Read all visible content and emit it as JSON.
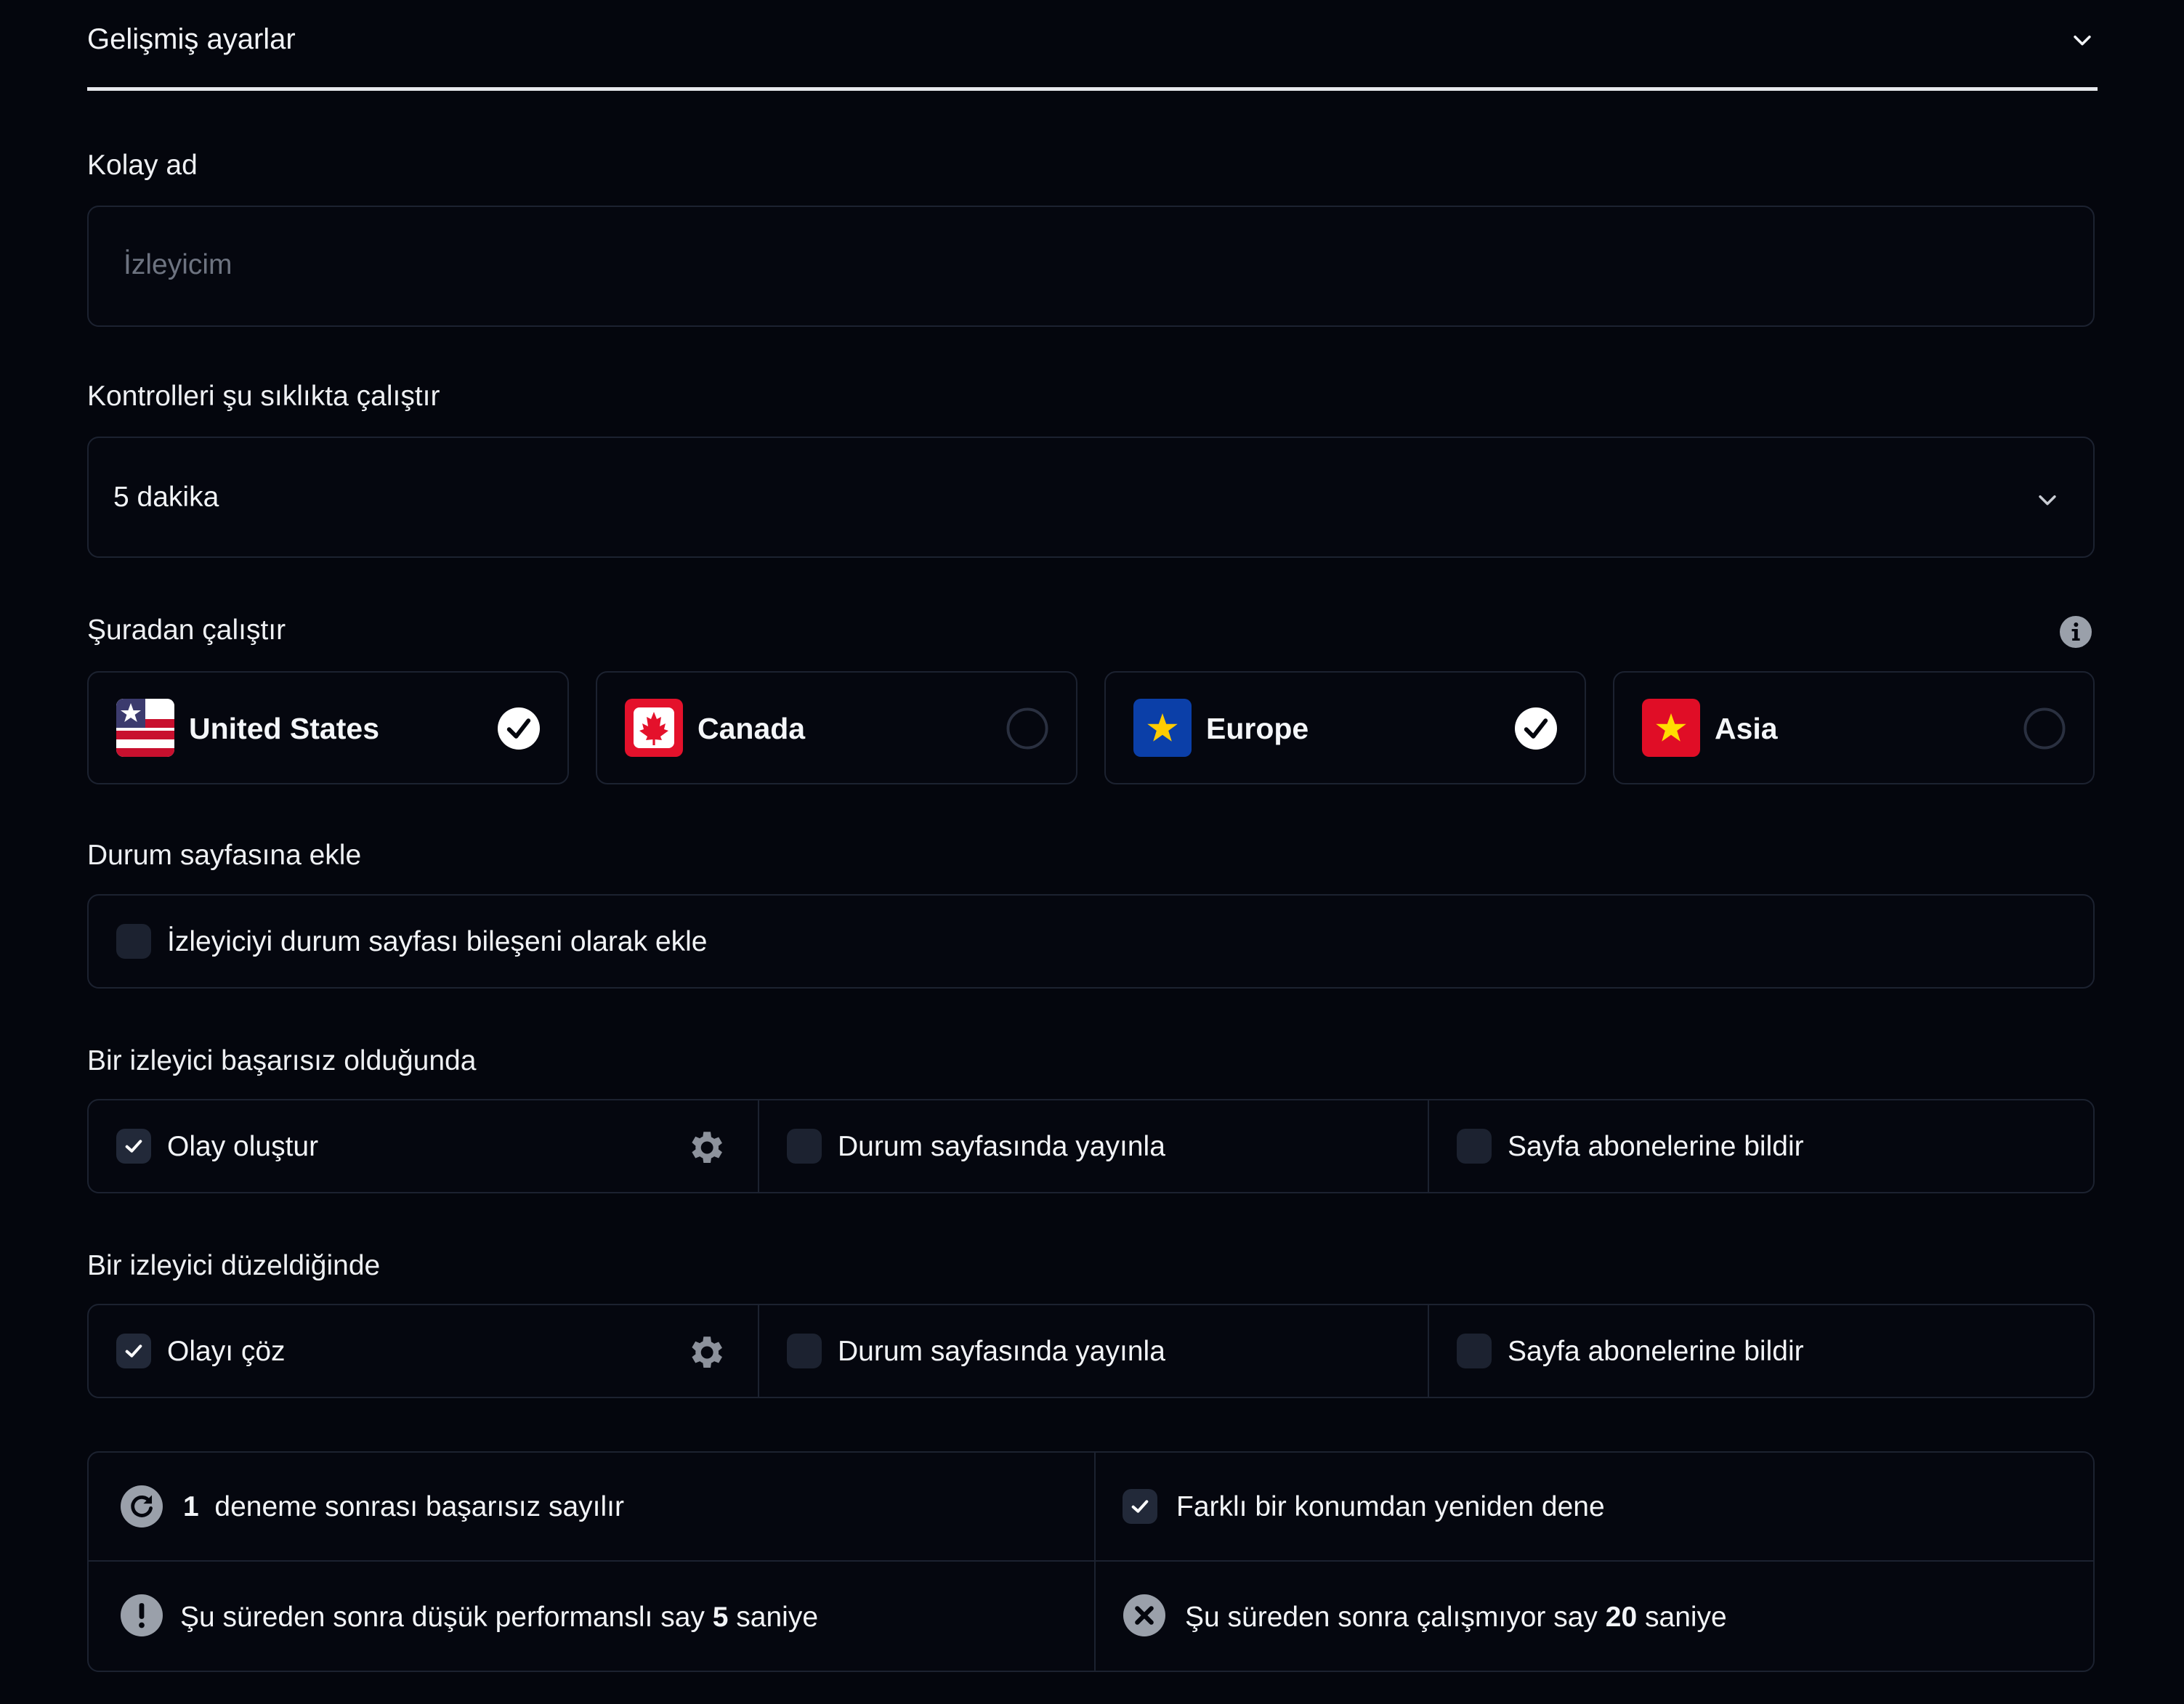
{
  "accordion": {
    "title": "Gelişmiş ayarlar"
  },
  "friendly_name": {
    "label": "Kolay ad",
    "placeholder": "İzleyicim"
  },
  "frequency": {
    "label": "Kontrolleri şu sıklıkta çalıştır",
    "value": "5 dakika"
  },
  "regions": {
    "label": "Şuradan çalıştır",
    "items": [
      {
        "name": "United States",
        "checked": true
      },
      {
        "name": "Canada",
        "checked": false
      },
      {
        "name": "Europe",
        "checked": true
      },
      {
        "name": "Asia",
        "checked": false
      }
    ]
  },
  "status_page": {
    "label": "Durum sayfasına ekle",
    "checkbox_label": "İzleyiciyi durum sayfası bileşeni olarak ekle",
    "checked": false
  },
  "on_fail": {
    "label": "Bir izleyici başarısız olduğunda",
    "options": [
      {
        "label": "Olay oluştur",
        "checked": true
      },
      {
        "label": "Durum sayfasında yayınla",
        "checked": false
      },
      {
        "label": "Sayfa abonelerine bildir",
        "checked": false
      }
    ]
  },
  "on_recover": {
    "label": "Bir izleyici düzeldiğinde",
    "options": [
      {
        "label": "Olayı çöz",
        "checked": true
      },
      {
        "label": "Durum sayfasında yayınla",
        "checked": false
      },
      {
        "label": "Sayfa abonelerine bildir",
        "checked": false
      }
    ]
  },
  "thresholds": {
    "retries_value": "1",
    "retries_text": "deneme sonrası başarısız sayılır",
    "retry_location_text": "Farklı bir konumdan yeniden dene",
    "retry_location_checked": true,
    "degraded_prefix": "Şu süreden sonra düşük performanslı say",
    "degraded_value": "5",
    "degraded_unit": "saniye",
    "down_prefix": "Şu süreden sonra çalışmıyor say",
    "down_value": "20",
    "down_unit": "saniye"
  },
  "colors": {
    "background": "#04060d",
    "border": "#1c2230",
    "text": "#f2f4f7",
    "muted": "#6d7380"
  }
}
